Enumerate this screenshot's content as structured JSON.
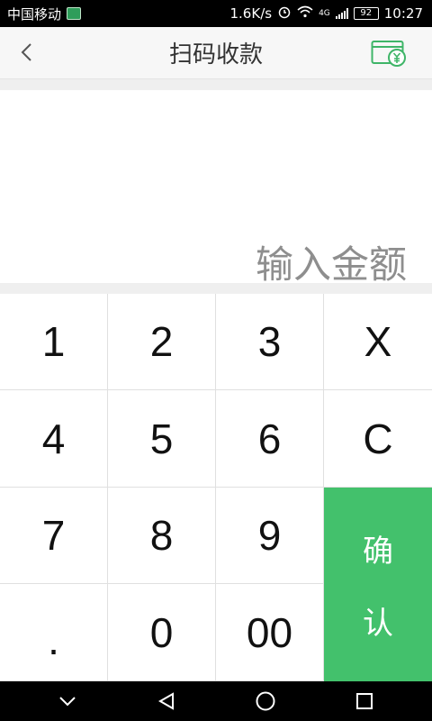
{
  "status_bar": {
    "carrier": "中国移动",
    "speed": "1.6K/s",
    "network": "4G",
    "battery": "92",
    "time": "10:27"
  },
  "header": {
    "title": "扫码收款",
    "back_icon": "chevron-left-icon",
    "wallet_icon": "wallet-yuan-icon"
  },
  "amount": {
    "placeholder": "输入金额"
  },
  "keypad": {
    "keys": [
      "1",
      "2",
      "3",
      "X",
      "4",
      "5",
      "6",
      "C",
      "7",
      "8",
      "9",
      ".",
      "0",
      "00"
    ],
    "confirm_chars": [
      "确",
      "认"
    ]
  },
  "colors": {
    "accent": "#43c16c",
    "header_bg": "#f7f7f7",
    "icon_green": "#3fb568"
  }
}
